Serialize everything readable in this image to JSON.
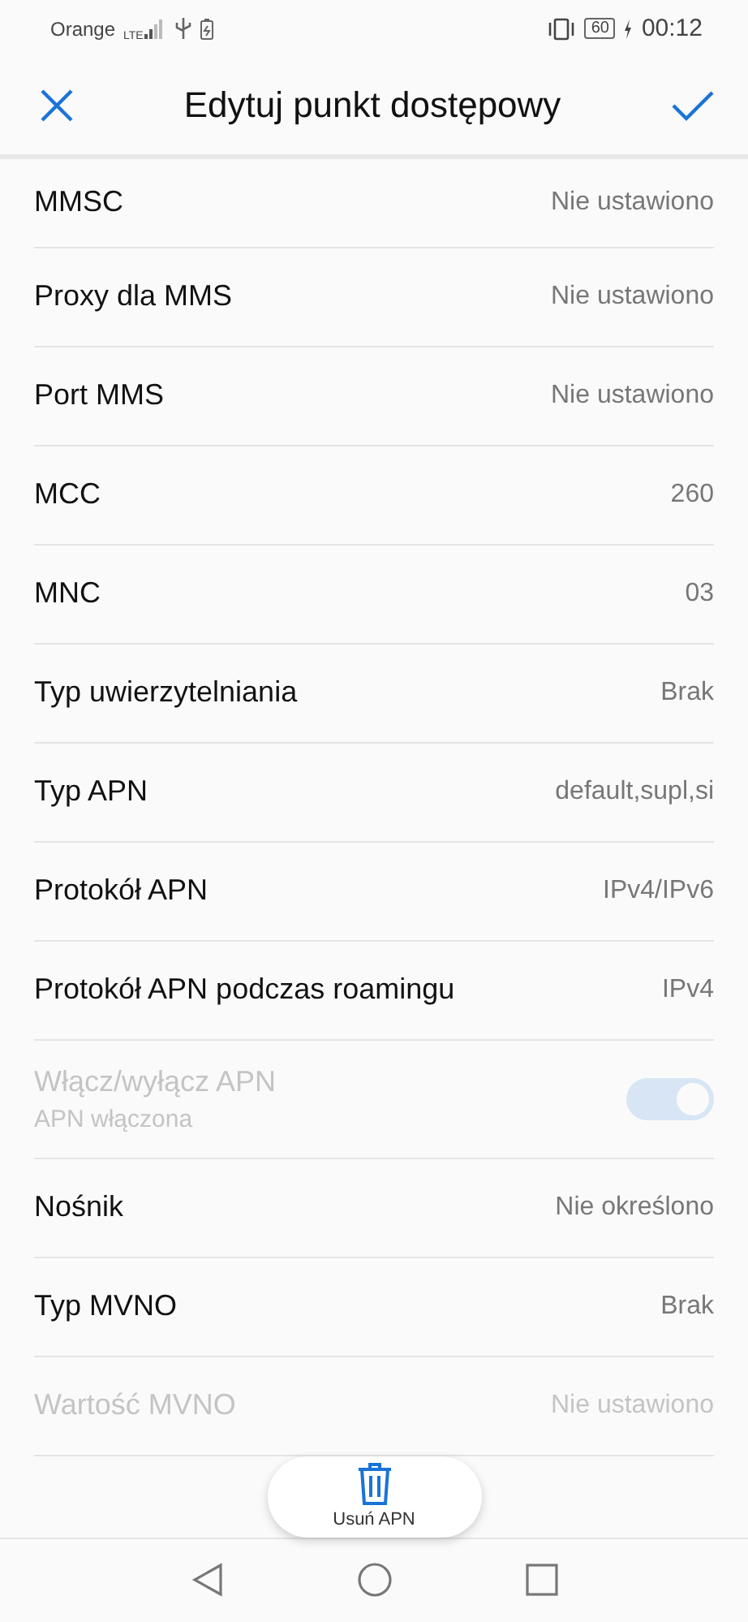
{
  "status_bar": {
    "carrier": "Orange",
    "network": "LTE",
    "battery": "60",
    "time": "00:12"
  },
  "header": {
    "title": "Edytuj punkt dostępowy"
  },
  "rows": [
    {
      "kind": "value",
      "label": "MMSC",
      "value": "Nie ustawiono",
      "disabled": false
    },
    {
      "kind": "value",
      "label": "Proxy dla MMS",
      "value": "Nie ustawiono",
      "disabled": false
    },
    {
      "kind": "value",
      "label": "Port MMS",
      "value": "Nie ustawiono",
      "disabled": false
    },
    {
      "kind": "value",
      "label": "MCC",
      "value": "260",
      "disabled": false
    },
    {
      "kind": "value",
      "label": "MNC",
      "value": "03",
      "disabled": false
    },
    {
      "kind": "value",
      "label": "Typ uwierzytelniania",
      "value": "Brak",
      "disabled": false
    },
    {
      "kind": "value",
      "label": "Typ APN",
      "value": "default,supl,si",
      "disabled": false
    },
    {
      "kind": "value",
      "label": "Protokół APN",
      "value": "IPv4/IPv6",
      "disabled": false
    },
    {
      "kind": "value",
      "label": "Protokół APN podczas roamingu",
      "value": "IPv4",
      "disabled": false
    },
    {
      "kind": "switch",
      "label": "Włącz/wyłącz APN",
      "subtitle": "APN włączona",
      "on": true,
      "disabled": true
    },
    {
      "kind": "value",
      "label": "Nośnik",
      "value": "Nie określono",
      "disabled": false
    },
    {
      "kind": "value",
      "label": "Typ MVNO",
      "value": "Brak",
      "disabled": false
    },
    {
      "kind": "value",
      "label": "Wartość MVNO",
      "value": "Nie ustawiono",
      "disabled": true
    }
  ],
  "delete_button": {
    "label": "Usuń APN"
  }
}
